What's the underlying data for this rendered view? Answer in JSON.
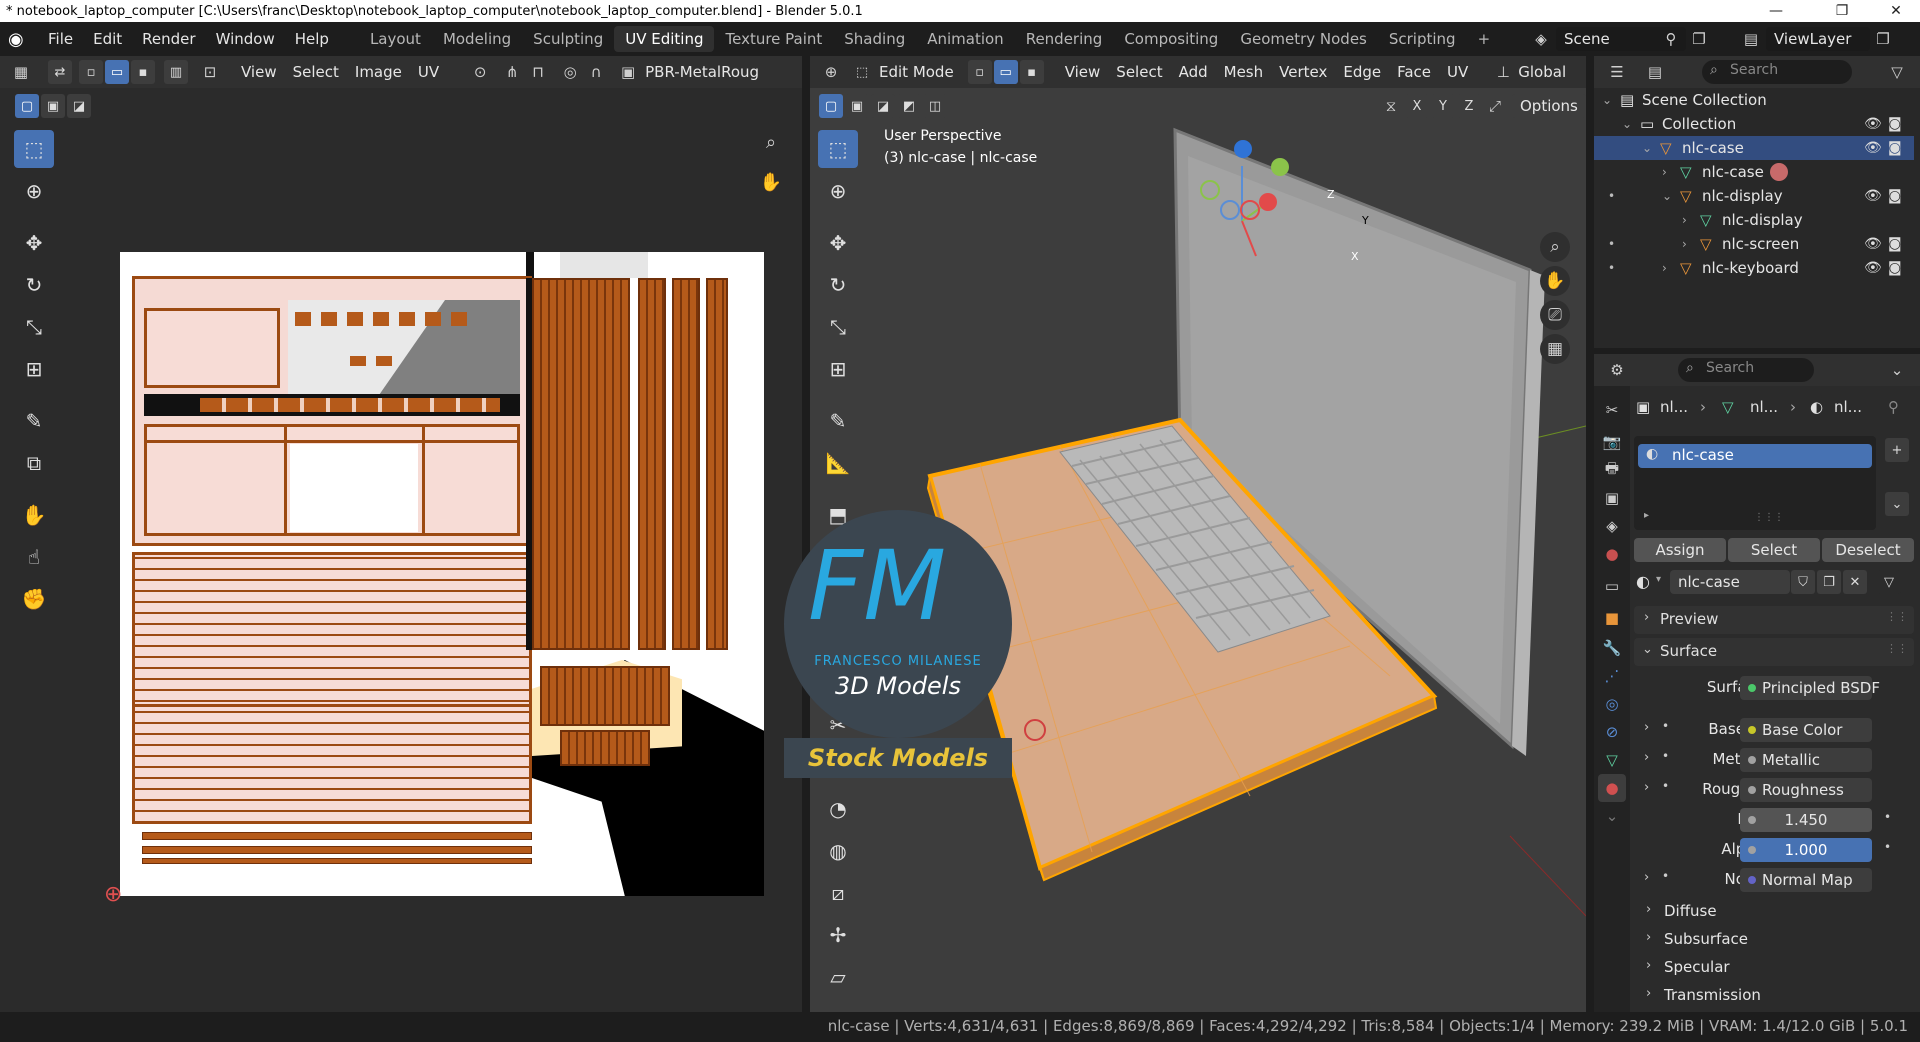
{
  "window": {
    "title": "* notebook_laptop_computer [C:\\Users\\franc\\Desktop\\notebook_laptop_computer\\notebook_laptop_computer.blend] - Blender 5.0.1",
    "minimize": "—",
    "maximize": "❐",
    "close": "✕"
  },
  "menus": [
    "File",
    "Edit",
    "Render",
    "Window",
    "Help"
  ],
  "workspaces": [
    "Layout",
    "Modeling",
    "Sculpting",
    "UV Editing",
    "Texture Paint",
    "Shading",
    "Animation",
    "Rendering",
    "Compositing",
    "Geometry Nodes",
    "Scripting"
  ],
  "workspace_add": "+",
  "scene": {
    "name": "Scene",
    "view_layer": "ViewLayer"
  },
  "uv_editor": {
    "menus": [
      "View",
      "Select",
      "Image",
      "UV"
    ],
    "image_name": "PBR-MetalRoug"
  },
  "viewport": {
    "mode": "Edit Mode",
    "menus": [
      "View",
      "Select",
      "Add",
      "Mesh",
      "Vertex",
      "Edge",
      "Face",
      "UV"
    ],
    "orientation": "Global",
    "axes": [
      "X",
      "Y",
      "Z"
    ],
    "options_label": "Options",
    "overlay_line1": "User Perspective",
    "overlay_line2": "(3) nlc-case | nlc-case",
    "gizmo_x": "X",
    "gizmo_y": "Y",
    "gizmo_z": "Z"
  },
  "watermark": {
    "logo": "FM",
    "name": "FRANCESCO MILANESE",
    "line": "3D Models",
    "badge": "Stock Models"
  },
  "outliner": {
    "search_placeholder": "Search",
    "rows": [
      {
        "label": "Scene Collection",
        "indent": 0,
        "type": "scene",
        "selected": false
      },
      {
        "label": "Collection",
        "indent": 1,
        "type": "collection",
        "selected": false
      },
      {
        "label": "nlc-case",
        "indent": 2,
        "type": "object",
        "selected": true
      },
      {
        "label": "nlc-case",
        "indent": 3,
        "type": "mesh",
        "selected": false
      },
      {
        "label": "nlc-display",
        "indent": 3,
        "type": "object",
        "selected": false
      },
      {
        "label": "nlc-display",
        "indent": 4,
        "type": "mesh",
        "selected": false
      },
      {
        "label": "nlc-screen",
        "indent": 4,
        "type": "object",
        "selected": false
      },
      {
        "label": "nlc-keyboard",
        "indent": 3,
        "type": "object",
        "selected": false
      }
    ]
  },
  "properties": {
    "search_placeholder": "Search",
    "breadcrumb": [
      "nl...",
      "nl...",
      "nl..."
    ],
    "material_slot": "nlc-case",
    "assign": "Assign",
    "select": "Select",
    "deselect": "Deselect",
    "material_name": "nlc-case",
    "panels": {
      "preview": "Preview",
      "surface": "Surface"
    },
    "surface_label": "Surface",
    "surface_value": "Principled BSDF",
    "inputs": [
      {
        "label": "Base ...",
        "value": "Base Color",
        "dot": "#c7c729"
      },
      {
        "label": "Meta...",
        "value": "Metallic",
        "dot": "#a1a1a1"
      },
      {
        "label": "Rough...",
        "value": "Roughness",
        "dot": "#a1a1a1"
      },
      {
        "label": "IOR",
        "value": "1.450",
        "dot": "#a1a1a1"
      },
      {
        "label": "Alpha",
        "value": "1.000",
        "dot": "#a1a1a1"
      },
      {
        "label": "Nor...",
        "value": "Normal Map",
        "dot": "#6363c7"
      }
    ],
    "subpanels": [
      "Diffuse",
      "Subsurface",
      "Specular",
      "Transmission"
    ]
  },
  "status": {
    "text": "nlc-case | Verts:4,631/4,631 | Edges:8,869/8,869 | Faces:4,292/4,292 | Tris:8,584 | Objects:1/4 | Memory: 239.2 MiB | VRAM: 1.4/12.0 GiB | 5.0.1"
  },
  "colors": {
    "accent": "#4772b3",
    "selection_orange": "#ffa500",
    "mesh_icon": "#e8953a",
    "uv_island": "#9c4a12"
  }
}
